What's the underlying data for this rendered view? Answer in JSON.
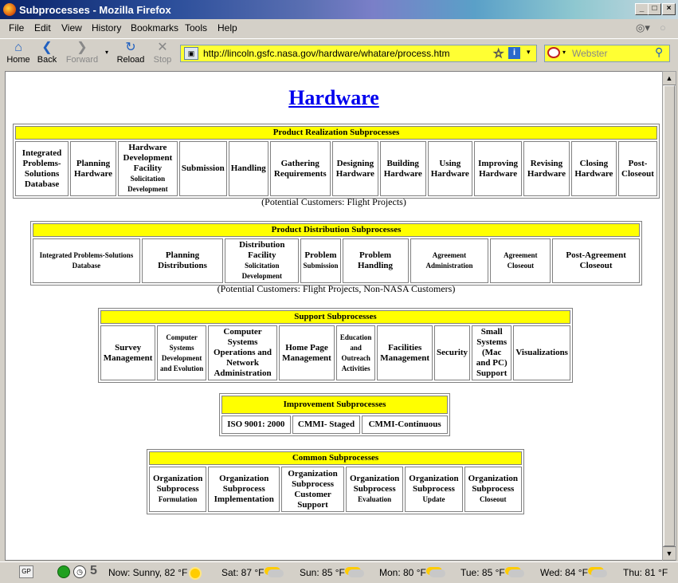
{
  "window": {
    "title": "Subprocesses - Mozilla Firefox"
  },
  "menu": [
    "File",
    "Edit",
    "View",
    "History",
    "Bookmarks",
    "Tools",
    "Help"
  ],
  "nav": {
    "home": "Home",
    "back": "Back",
    "forward": "Forward",
    "reload": "Reload",
    "stop": "Stop"
  },
  "url": "http://lincoln.gsfc.nasa.gov/hardware/whatare/process.htm",
  "search": {
    "placeholder": "Webster"
  },
  "page": {
    "title": "Hardware",
    "realization": {
      "header": "Product Realization Subprocesses",
      "cells": [
        {
          "main": "Integrated Problems-Solutions Database",
          "sub": ""
        },
        {
          "main": "Planning Hardware",
          "sub": ""
        },
        {
          "main": "Hardware Development Facility",
          "sub": "Solicitation Development"
        },
        {
          "main": "Submission",
          "sub": ""
        },
        {
          "main": "Handling",
          "sub": ""
        },
        {
          "main": "Gathering Requirements",
          "sub": ""
        },
        {
          "main": "Designing Hardware",
          "sub": ""
        },
        {
          "main": "Building Hardware",
          "sub": ""
        },
        {
          "main": "Using Hardware",
          "sub": ""
        },
        {
          "main": "Improving Hardware",
          "sub": ""
        },
        {
          "main": "Revising Hardware",
          "sub": ""
        },
        {
          "main": "Closing Hardware",
          "sub": ""
        },
        {
          "main": "Post-Closeout",
          "sub": ""
        }
      ],
      "note": "(Potential Customers: Flight Projects)"
    },
    "distribution": {
      "header": "Product Distribution Subprocesses",
      "cells": [
        {
          "main": "",
          "sub": "Integrated Problems-Solutions Database"
        },
        {
          "main": "Planning Distributions",
          "sub": ""
        },
        {
          "main": "Distribution Facility",
          "sub": "Solicitation Development"
        },
        {
          "main": "Problem",
          "sub": "Submission"
        },
        {
          "main": "Problem Handling",
          "sub": ""
        },
        {
          "main": "",
          "sub": "Agreement Administration"
        },
        {
          "main": "",
          "sub": "Agreement Closeout"
        },
        {
          "main": "Post-Agreement Closeout",
          "sub": ""
        }
      ],
      "note": "(Potential Customers: Flight Projects, Non-NASA Customers)"
    },
    "support": {
      "header": "Support Subprocesses",
      "cells": [
        {
          "main": "Survey Management",
          "sub": ""
        },
        {
          "main": "",
          "sub": "Computer Systems Development and Evolution"
        },
        {
          "main": "Computer Systems Operations and Network Administration",
          "sub": ""
        },
        {
          "main": "Home Page Management",
          "sub": ""
        },
        {
          "main": "",
          "sub": "Education and Outreach Activities"
        },
        {
          "main": "Facilities Management",
          "sub": ""
        },
        {
          "main": "Security",
          "sub": ""
        },
        {
          "main": "Small Systems (Mac and PC) Support",
          "sub": ""
        },
        {
          "main": "Visualizations",
          "sub": ""
        }
      ]
    },
    "improvement": {
      "header": "Improvement Subprocesses",
      "cells": [
        {
          "main": "ISO 9001: 2000",
          "sub": ""
        },
        {
          "main": "CMMI- Staged",
          "sub": ""
        },
        {
          "main": "CMMI-Continuous",
          "sub": ""
        }
      ]
    },
    "common": {
      "header": "Common Subprocesses",
      "cells": [
        {
          "main": "Organization Subprocess",
          "sub": "Formulation"
        },
        {
          "main": "Organization Subprocess Implementation",
          "sub": ""
        },
        {
          "main": "Organization Subprocess Customer Support",
          "sub": ""
        },
        {
          "main": "Organization Subprocess",
          "sub": "Evaluation"
        },
        {
          "main": "Organization Subprocess",
          "sub": "Update"
        },
        {
          "main": "Organization Subprocess",
          "sub": "Closeout"
        }
      ]
    }
  },
  "status": {
    "gp": "GP",
    "count": "5",
    "weather": [
      {
        "label": "Now: Sunny, 82 °F",
        "icon": "sun-icon"
      },
      {
        "label": "Sat: 87 °F",
        "icon": "partly-cloudy-icon"
      },
      {
        "label": "Sun: 85 °F",
        "icon": "partly-cloudy-icon"
      },
      {
        "label": "Mon: 80 °F",
        "icon": "partly-cloudy-icon"
      },
      {
        "label": "Tue: 85 °F",
        "icon": "partly-cloudy-icon"
      },
      {
        "label": "Wed: 84 °F",
        "icon": "partly-cloudy-icon"
      },
      {
        "label": "Thu: 81 °F",
        "icon": "partly-cloudy-icon"
      }
    ]
  }
}
